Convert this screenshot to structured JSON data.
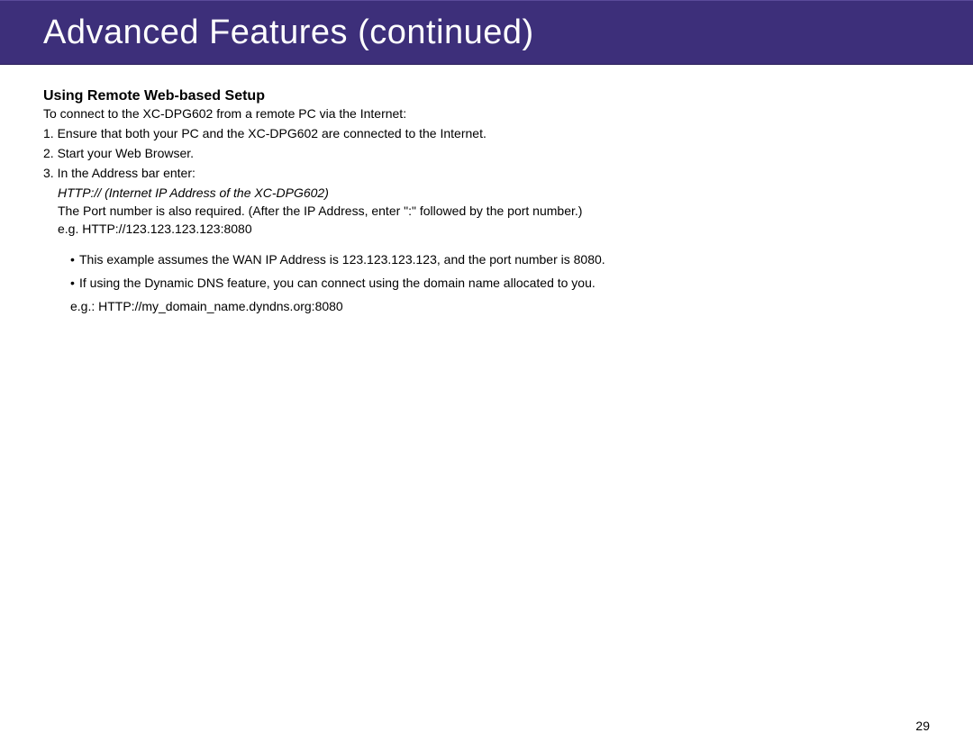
{
  "header": {
    "title": "Advanced Features (continued)"
  },
  "section": {
    "heading": "Using Remote Web-based Setup",
    "intro": "To connect to the XC-DPG602 from a remote PC via the Internet:",
    "steps": {
      "s1": "1. Ensure that both your PC and the XC-DPG602 are connected to the Internet.",
      "s2": "2. Start your Web Browser.",
      "s3": "3. In the Address bar enter:",
      "s3_sub_italic": "HTTP:// (Internet IP Address of the XC-DPG602)",
      "s3_sub_port": "The Port number is also required. (After the IP Address, enter \":\" followed by the port number.)",
      "s3_eg": "e.g.  HTTP://123.123.123.123:8080"
    },
    "bullets": {
      "b1": "This example assumes the WAN IP Address is 123.123.123.123, and the port number is 8080.",
      "b2": "If using the Dynamic DNS feature, you can connect using the domain name allocated to you.",
      "b2_eg": "e.g.: HTTP://my_domain_name.dyndns.org:8080"
    }
  },
  "page_number": "29"
}
